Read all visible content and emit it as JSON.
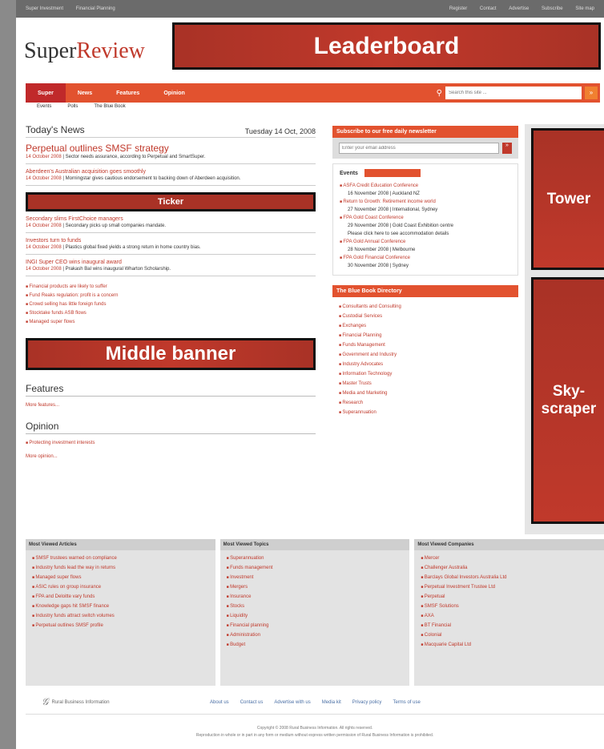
{
  "topbar": {
    "left": [
      "Super Investment",
      "Financial Planning"
    ],
    "right": [
      "Register",
      "Contact",
      "Advertise",
      "Subscribe",
      "Site map"
    ]
  },
  "logo": {
    "part1": "Super",
    "part2": "Review"
  },
  "ads": {
    "leaderboard": "Leaderboard",
    "ticker": "Ticker",
    "middle": "Middle banner",
    "tower": "Tower",
    "skyscraper": "Sky-\nscraper"
  },
  "nav": {
    "tabs": [
      "Super",
      "News",
      "Features",
      "Opinion"
    ],
    "search_placeholder": "Search this site ...",
    "search_go": "»"
  },
  "subnav": [
    "Events",
    "Polls",
    "The Blue Book"
  ],
  "news": {
    "heading": "Today's News",
    "date": "Tuesday 14 Oct, 2008",
    "stories": [
      {
        "title": "Perpetual outlines SMSF strategy",
        "when": "14 October 2008",
        "text": "Sector needs assurance, according to Perpetual and SmartSuper."
      },
      {
        "title": "Aberdeen's Australian acquisition goes smoothly",
        "when": "14 October 2008",
        "text": "Morningstar gives cautious endorsement to backing down of Aberdeen acquisition."
      }
    ],
    "stories2": [
      {
        "title": "Secondary slims FirstChoice managers",
        "when": "14 October 2008",
        "text": "Secondary picks up small companies mandate."
      },
      {
        "title": "Investors turn to funds",
        "when": "14 October 2008",
        "text": "Plastics global fixed yields a strong return in home country bias."
      },
      {
        "title": "INGI Super CEO wins inaugural award",
        "when": "14 October 2008",
        "text": "Prakash Bal wins inaugural Wharton Scholarship."
      }
    ],
    "bullets": [
      "Financial products are likely to suffer",
      "Fund Reaks regulation: profit is a concern",
      "Crowd selling has little foreign funds",
      "Stocktake funds ASB flows",
      "Managed super flows"
    ]
  },
  "features": {
    "heading": "Features",
    "link": "More features..."
  },
  "opinion": {
    "heading": "Opinion",
    "item": "Protecting investment interests",
    "link": "More opinion..."
  },
  "newsletter": {
    "heading": "Subscribe to our free daily newsletter",
    "placeholder": "Enter your email address",
    "go": "»"
  },
  "events": {
    "tab": "Events",
    "items": [
      {
        "title": "ASFA Credit Education Conference",
        "detail": "16 November 2008 | Auckland NZ"
      },
      {
        "title": "Return to Growth: Retirement income world",
        "detail": "27 November 2008 | International, Sydney"
      },
      {
        "title": "FPA Gold Coast Conference",
        "detail": "29 November 2008 | Gold Coast Exhibition centre"
      },
      {
        "title": "Please click here to see accommodation details",
        "detail": ""
      },
      {
        "title": "FPA Gold Annual Conference",
        "detail": "28 November 2008 | Melbourne"
      },
      {
        "title": "FPA Gold Financial Conference",
        "detail": "30 November 2008 | Sydney"
      }
    ]
  },
  "bluebook": {
    "heading": "The Blue Book Directory",
    "items": [
      "Consultants and Consulting",
      "Custodial Services",
      "Exchanges",
      "Financial Planning",
      "Funds Management",
      "Government and Industry",
      "Industry Advocates",
      "Information Technology",
      "Master Trusts",
      "Media and Marketing",
      "Research",
      "Superannuation"
    ]
  },
  "most_viewed": [
    {
      "heading": "Most Viewed Articles",
      "items": [
        "SMSF trustees warned on compliance",
        "Industry funds lead the way in returns",
        "Managed super flows",
        "ASIC rules on group insurance",
        "FPA and Deloitte vary funds",
        "Knowledge gaps hit SMSF finance",
        "Industry funds attract switch volumes",
        "Perpetual outlines SMSF profile"
      ]
    },
    {
      "heading": "Most Viewed Topics",
      "items": [
        "Superannuation",
        "Funds management",
        "Investment",
        "Mergers",
        "Insurance",
        "Stocks",
        "Liquidity",
        "Financial planning",
        "Administration",
        "Budget"
      ]
    },
    {
      "heading": "Most Viewed Companies",
      "items": [
        "Mercer",
        "Challenger Australia",
        "Barclays Global Investors Australia Ltd",
        "Perpetual Investment Trustee Ltd",
        "Perpetual",
        "SMSF Solutions",
        "AXA",
        "BT Financial",
        "Colonial",
        "Macquarie Capital Ltd"
      ]
    }
  ],
  "footer": {
    "brand": "Rural Business Information",
    "links": [
      "About us",
      "Contact us",
      "Advertise with us",
      "Media kit",
      "Privacy policy",
      "Terms of use"
    ],
    "copyright": "Copyright © 2008 Rural Business Information. All rights reserved.",
    "notice": "Reproduction in whole or in part in any form or medium without express written permission of Rural Business Information is prohibited."
  }
}
